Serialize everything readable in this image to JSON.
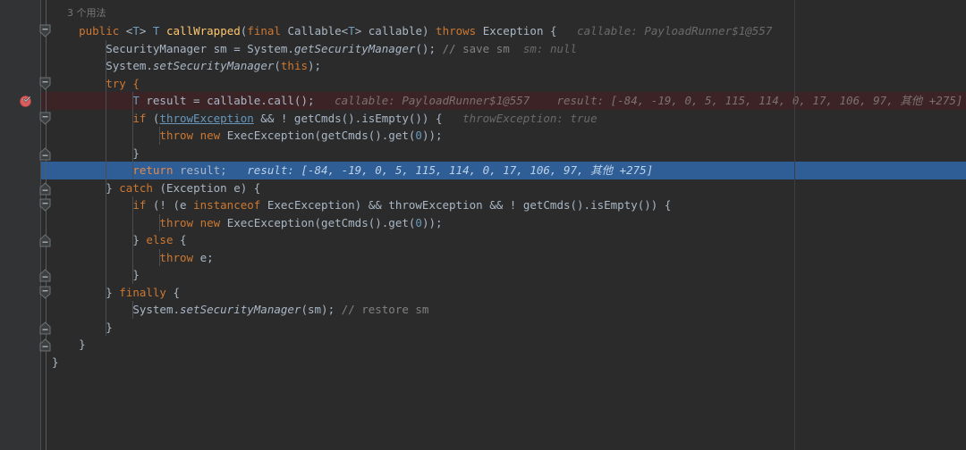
{
  "app": {
    "kind": "code-editor",
    "theme": "darcula",
    "colors": {
      "editor_bg": "#2b2b2b",
      "gutter_bg": "#313335",
      "text": "#a9b7c6",
      "keyword": "#cc7832",
      "comment": "#808080",
      "number": "#6897bb",
      "method": "#ffc66d",
      "field": "#9876aa",
      "hint": "#6a6a6a",
      "exec_line_bg": "#3c2426",
      "selected_line_bg": "#2f5d96",
      "breakpoint": "#db5c5c",
      "margin_guide": "#3c3f41"
    }
  },
  "codevision": {
    "line": 68,
    "label": "3 个用法"
  },
  "gutter": {
    "breakpoint_line": 72,
    "breakpoint_icon": "breakpoint-verified-icon",
    "current_line": 76,
    "fold_open_lines": [
      68,
      71,
      73,
      78,
      83
    ],
    "fold_close_lines": [
      75,
      77,
      80,
      82,
      85,
      86
    ]
  },
  "lines": [
    {
      "no": 68,
      "indent": 4,
      "tokens": [
        {
          "t": "public ",
          "c": "kw"
        },
        {
          "t": "<",
          "c": "typ"
        },
        {
          "t": "T",
          "c": "gen"
        },
        {
          "t": "> ",
          "c": "typ"
        },
        {
          "t": "T ",
          "c": "gen"
        },
        {
          "t": "callWrapped",
          "c": "mtd"
        },
        {
          "t": "(",
          "c": "typ"
        },
        {
          "t": "final ",
          "c": "kw"
        },
        {
          "t": "Callable<",
          "c": "typ"
        },
        {
          "t": "T",
          "c": "gen"
        },
        {
          "t": "> callable) ",
          "c": "typ"
        },
        {
          "t": "throws ",
          "c": "kw"
        },
        {
          "t": "Exception {",
          "c": "typ"
        }
      ],
      "hints": [
        {
          "text": "callable: PayloadRunner$1@557",
          "gap": 3
        }
      ]
    },
    {
      "no": 69,
      "indent": 8,
      "tokens": [
        {
          "t": "SecurityManager sm = System.",
          "c": "typ"
        },
        {
          "t": "getSecurityManager",
          "c": "typ ital"
        },
        {
          "t": "(); ",
          "c": "typ"
        },
        {
          "t": "// save sm",
          "c": "cmt"
        }
      ],
      "hints": [
        {
          "text": "sm: null",
          "gap": 2
        }
      ]
    },
    {
      "no": 70,
      "indent": 8,
      "tokens": [
        {
          "t": "System.",
          "c": "typ"
        },
        {
          "t": "setSecurityManager",
          "c": "typ ital"
        },
        {
          "t": "(",
          "c": "typ"
        },
        {
          "t": "this",
          "c": "kw"
        },
        {
          "t": ");",
          "c": "typ"
        }
      ],
      "hints": []
    },
    {
      "no": 71,
      "indent": 8,
      "tokens": [
        {
          "t": "try {",
          "c": "kw"
        }
      ],
      "hints": []
    },
    {
      "no": 72,
      "indent": 12,
      "highlight": "exec",
      "tokens": [
        {
          "t": "T",
          "c": "gen"
        },
        {
          "t": " result = callable.call();",
          "c": "typ"
        }
      ],
      "hints": [
        {
          "text": "callable: PayloadRunner$1@557",
          "gap": 3
        },
        {
          "text": "result: [-84, -19, 0, 5, 115, 114, 0, 17, 106, 97, 其他 +275]",
          "gap": 4
        }
      ]
    },
    {
      "no": 73,
      "indent": 12,
      "tokens": [
        {
          "t": "if ",
          "c": "kw"
        },
        {
          "t": "(",
          "c": "typ"
        },
        {
          "t": "throwException",
          "c": "lnk"
        },
        {
          "t": " && ! getCmds().isEmpty()) {",
          "c": "typ"
        }
      ],
      "hints": [
        {
          "text": "throwException: true",
          "gap": 3
        }
      ]
    },
    {
      "no": 74,
      "indent": 16,
      "tokens": [
        {
          "t": "throw ",
          "c": "kw"
        },
        {
          "t": "new ",
          "c": "kw"
        },
        {
          "t": "ExecException(getCmds().get(",
          "c": "typ"
        },
        {
          "t": "0",
          "c": "num"
        },
        {
          "t": "));",
          "c": "typ"
        }
      ],
      "hints": []
    },
    {
      "no": 75,
      "indent": 12,
      "tokens": [
        {
          "t": "}",
          "c": "typ"
        }
      ],
      "hints": []
    },
    {
      "no": 76,
      "indent": 12,
      "highlight": "selected",
      "tokens": [
        {
          "t": "return ",
          "c": "sel-kw"
        },
        {
          "t": "result;",
          "c": "typ"
        }
      ],
      "hints": [
        {
          "text": "result: [-84, -19, 0, 5, 115, 114, 0, 17, 106, 97, 其他 +275]",
          "gap": 3
        }
      ]
    },
    {
      "no": 77,
      "indent": 8,
      "tokens": [
        {
          "t": "} ",
          "c": "typ"
        },
        {
          "t": "catch ",
          "c": "kw"
        },
        {
          "t": "(Exception e) {",
          "c": "typ"
        }
      ],
      "hints": []
    },
    {
      "no": 78,
      "indent": 12,
      "tokens": [
        {
          "t": "if ",
          "c": "kw"
        },
        {
          "t": "(! (e ",
          "c": "typ"
        },
        {
          "t": "instanceof ",
          "c": "kw"
        },
        {
          "t": "ExecException) && throwException && ! getCmds().isEmpty()) {",
          "c": "typ"
        }
      ],
      "hints": []
    },
    {
      "no": 79,
      "indent": 16,
      "tokens": [
        {
          "t": "throw ",
          "c": "kw"
        },
        {
          "t": "new ",
          "c": "kw"
        },
        {
          "t": "ExecException(getCmds().get(",
          "c": "typ"
        },
        {
          "t": "0",
          "c": "num"
        },
        {
          "t": "));",
          "c": "typ"
        }
      ],
      "hints": []
    },
    {
      "no": 80,
      "indent": 12,
      "tokens": [
        {
          "t": "} ",
          "c": "typ"
        },
        {
          "t": "else ",
          "c": "kw"
        },
        {
          "t": "{",
          "c": "typ"
        }
      ],
      "hints": []
    },
    {
      "no": 81,
      "indent": 16,
      "tokens": [
        {
          "t": "throw ",
          "c": "kw"
        },
        {
          "t": "e;",
          "c": "typ"
        }
      ],
      "hints": []
    },
    {
      "no": 82,
      "indent": 12,
      "tokens": [
        {
          "t": "}",
          "c": "typ"
        }
      ],
      "hints": []
    },
    {
      "no": 83,
      "indent": 8,
      "tokens": [
        {
          "t": "} ",
          "c": "typ"
        },
        {
          "t": "finally ",
          "c": "kw"
        },
        {
          "t": "{",
          "c": "typ"
        }
      ],
      "hints": []
    },
    {
      "no": 84,
      "indent": 12,
      "tokens": [
        {
          "t": "System.",
          "c": "typ"
        },
        {
          "t": "setSecurityManager",
          "c": "typ ital"
        },
        {
          "t": "(sm); ",
          "c": "typ"
        },
        {
          "t": "// restore sm",
          "c": "cmt"
        }
      ],
      "hints": []
    },
    {
      "no": 85,
      "indent": 8,
      "tokens": [
        {
          "t": "}",
          "c": "typ"
        }
      ],
      "hints": []
    },
    {
      "no": 86,
      "indent": 4,
      "tokens": [
        {
          "t": "}",
          "c": "typ"
        }
      ],
      "hints": []
    },
    {
      "no": 87,
      "indent": 0,
      "tokens": [
        {
          "t": "}",
          "c": "typ"
        }
      ],
      "hints": []
    },
    {
      "no": 88,
      "indent": 0,
      "tokens": [],
      "hints": []
    }
  ]
}
